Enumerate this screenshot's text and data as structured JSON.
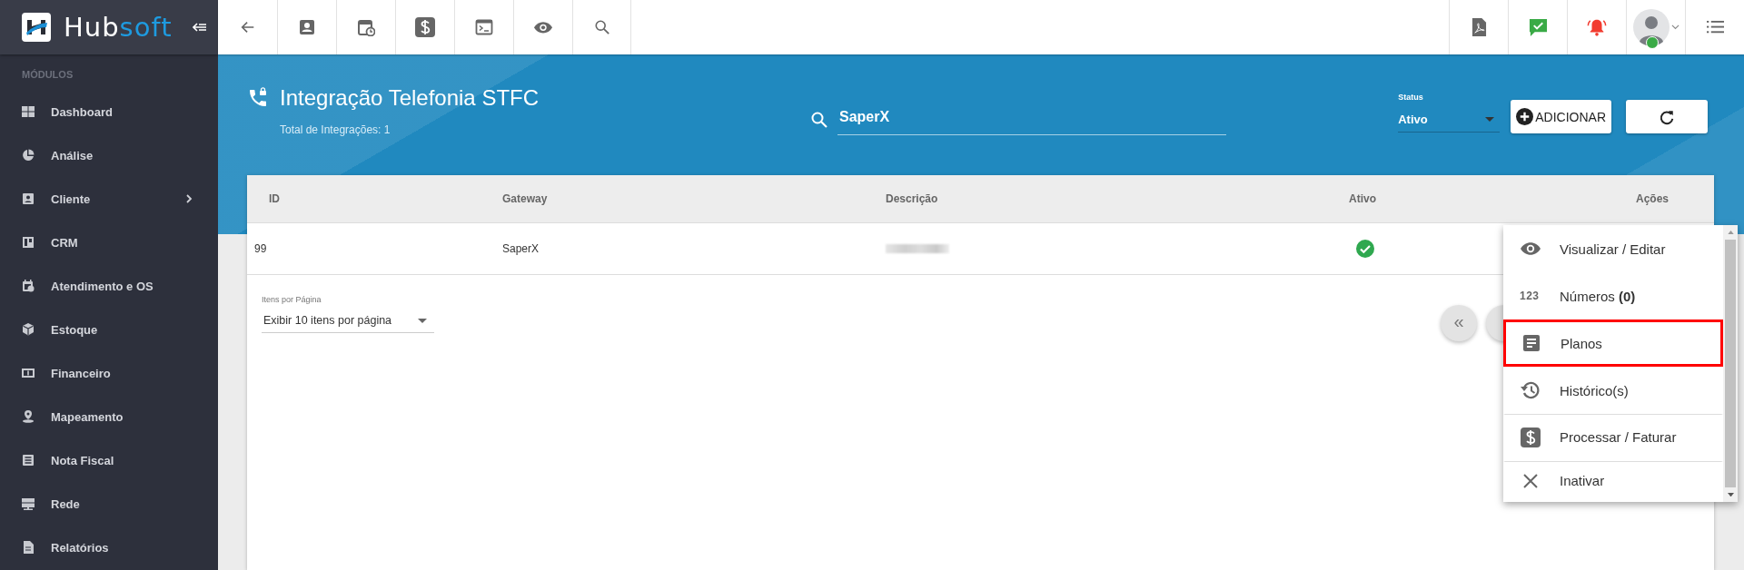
{
  "logo": {
    "part_a": "Hub",
    "part_b": "soft"
  },
  "sidebar": {
    "section": "MÓDULOS",
    "items": [
      {
        "label": "Dashboard",
        "has_submenu": false
      },
      {
        "label": "Análise",
        "has_submenu": false
      },
      {
        "label": "Cliente",
        "has_submenu": true
      },
      {
        "label": "CRM",
        "has_submenu": false
      },
      {
        "label": "Atendimento e OS",
        "has_submenu": false
      },
      {
        "label": "Estoque",
        "has_submenu": false
      },
      {
        "label": "Financeiro",
        "has_submenu": false
      },
      {
        "label": "Mapeamento",
        "has_submenu": false
      },
      {
        "label": "Nota Fiscal",
        "has_submenu": false
      },
      {
        "label": "Rede",
        "has_submenu": false
      },
      {
        "label": "Relatórios",
        "has_submenu": false
      }
    ]
  },
  "user": {
    "online": true
  },
  "header": {
    "title": "Integração Telefonia STFC",
    "subtitle": "Total de Integrações: 1",
    "search": {
      "value": "SaperX"
    },
    "status": {
      "label": "Status",
      "value": "Ativo"
    },
    "add_button": "ADICIONAR"
  },
  "table": {
    "columns": [
      "ID",
      "Gateway",
      "Descrição",
      "Ativo",
      "Ações"
    ],
    "rows": [
      {
        "id": "99",
        "gateway": "SaperX",
        "active": true
      }
    ]
  },
  "pagination": {
    "label": "Itens por Página",
    "value": "Exibir 10 itens por página",
    "first_button": "«"
  },
  "actions_menu": {
    "items": [
      {
        "label": "Visualizar / Editar",
        "highlighted": false,
        "separated": false
      },
      {
        "label": "Números **(0)**",
        "glyph": "123",
        "highlighted": false,
        "separated": false
      },
      {
        "label": "Planos",
        "highlighted": true,
        "separated": false
      },
      {
        "label": "Histórico(s)",
        "highlighted": false,
        "separated": false
      },
      {
        "label": "Processar / Faturar",
        "highlighted": false,
        "separated": true
      },
      {
        "label": "Inativar",
        "highlighted": false,
        "separated": true
      }
    ]
  }
}
